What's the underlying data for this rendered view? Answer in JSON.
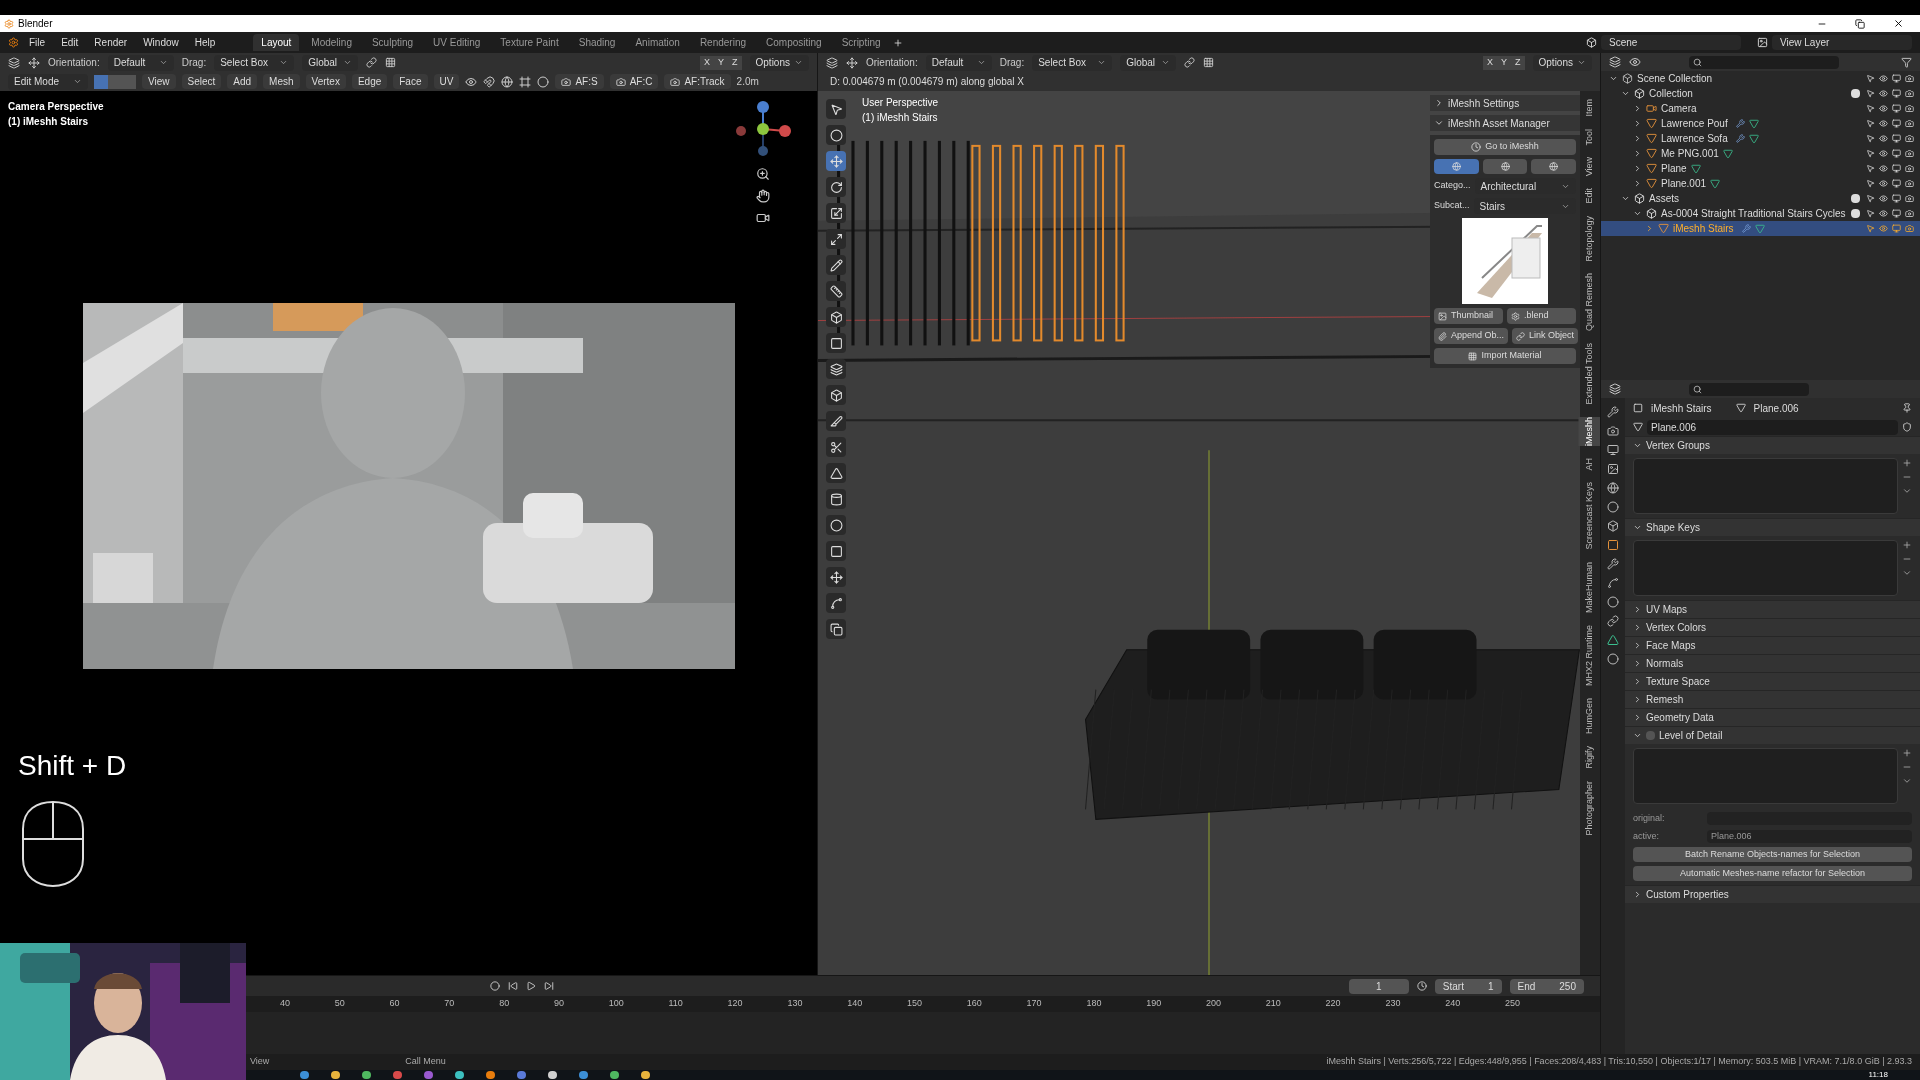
{
  "window": {
    "title": "Blender"
  },
  "menu": [
    "File",
    "Edit",
    "Render",
    "Window",
    "Help"
  ],
  "workspaces": [
    {
      "label": "Layout",
      "selected": true
    },
    {
      "label": "Modeling",
      "selected": false
    },
    {
      "label": "Sculpting",
      "selected": false
    },
    {
      "label": "UV Editing",
      "selected": false
    },
    {
      "label": "Texture Paint",
      "selected": false
    },
    {
      "label": "Shading",
      "selected": false
    },
    {
      "label": "Animation",
      "selected": false
    },
    {
      "label": "Rendering",
      "selected": false
    },
    {
      "label": "Compositing",
      "selected": false
    },
    {
      "label": "Scripting",
      "selected": false
    }
  ],
  "scene": "Scene",
  "view_layer": "View Layer",
  "left_view": {
    "header": {
      "orientation_label": "Orientation:",
      "orientation": "Default",
      "drag_label": "Drag:",
      "drag": "Select Box",
      "transform": "Global",
      "axes": [
        "X",
        "Y",
        "Z"
      ],
      "options": "Options"
    },
    "mode": "Edit Mode",
    "select_modes": [
      {
        "selected": true
      },
      {
        "selected": false
      },
      {
        "selected": false
      }
    ],
    "menus": [
      "View",
      "Select",
      "Add",
      "Mesh",
      "Vertex",
      "Edge",
      "Face",
      "UV"
    ],
    "addon_buttons": [
      "AF:S",
      "AF:C",
      "AF:Track"
    ],
    "distance": "2.0m",
    "overlay": [
      "Camera Perspective",
      "(1) iMeshh Stairs"
    ],
    "shortcut": "Shift + D"
  },
  "right_view": {
    "header": {
      "orientation_label": "Orientation:",
      "orientation": "Default",
      "drag_label": "Drag:",
      "drag": "Select Box",
      "transform": "Global",
      "axes": [
        "X",
        "Y",
        "Z"
      ],
      "options": "Options"
    },
    "status": "D: 0.004679 m (0.004679 m) along global X",
    "overlay": [
      "User Perspective",
      "(1) iMeshh Stairs"
    ]
  },
  "n_panel": {
    "panels": [
      {
        "title": "iMeshh Settings",
        "expanded": false
      },
      {
        "title": "iMeshh Asset Manager",
        "expanded": true
      }
    ],
    "go_button": "Go to iMeshh",
    "asset_types": [
      {
        "selected": true
      },
      {
        "selected": false
      },
      {
        "selected": false
      }
    ],
    "category_label": "Catego...",
    "category": "Architectural",
    "subcategory_label": "Subcat...",
    "subcategory": "Stairs",
    "thumbnail_button": "Thumbnail",
    "blend_button": ".blend",
    "append_button": "Append Ob...",
    "link_button": "Link Object",
    "import_button": "Import Material",
    "tabs": [
      {
        "label": "Item",
        "selected": false
      },
      {
        "label": "Tool",
        "selected": false
      },
      {
        "label": "View",
        "selected": false
      },
      {
        "label": "Edit",
        "selected": false
      },
      {
        "label": "Retopology",
        "selected": false
      },
      {
        "label": "Quad Remesh",
        "selected": false
      },
      {
        "label": "Extended Tools",
        "selected": false
      },
      {
        "label": "iMeshh",
        "selected": true
      },
      {
        "label": "AH",
        "selected": false
      },
      {
        "label": "Screencast Keys",
        "selected": false
      },
      {
        "label": "MakeHuman",
        "selected": false
      },
      {
        "label": "MHX2 Runtime",
        "selected": false
      },
      {
        "label": "HumGen",
        "selected": false
      },
      {
        "label": "Rigify",
        "selected": false
      },
      {
        "label": "Photographer",
        "selected": false
      }
    ]
  },
  "outliner": {
    "tree": [
      {
        "name": "Scene Collection",
        "kind": "scene",
        "selected": false,
        "children": [
          {
            "name": "Collection",
            "kind": "collection",
            "selected": false,
            "checked": true,
            "children": [
              {
                "name": "Camera",
                "kind": "camera",
                "selected": false
              },
              {
                "name": "Lawrence Pouf",
                "kind": "mesh",
                "selected": false,
                "modifiers": true
              },
              {
                "name": "Lawrence Sofa",
                "kind": "mesh",
                "selected": false,
                "modifiers": true
              },
              {
                "name": "Me PNG.001",
                "kind": "mesh",
                "selected": false,
                "modifiers": false
              },
              {
                "name": "Plane",
                "kind": "mesh",
                "selected": false,
                "modifiers": false
              },
              {
                "name": "Plane.001",
                "kind": "mesh",
                "selected": false,
                "modifiers": false
              }
            ]
          },
          {
            "name": "Assets",
            "kind": "collection",
            "selected": false,
            "checked": true,
            "children": [
              {
                "name": "As-0004 Straight Traditional Stairs Cycles",
                "kind": "collection",
                "selected": false,
                "checked": true,
                "children": [
                  {
                    "name": "iMeshh Stairs",
                    "kind": "mesh",
                    "selected": true,
                    "modifiers": true
                  }
                ]
              }
            ]
          }
        ]
      }
    ]
  },
  "properties": {
    "object": "iMeshh Stairs",
    "mesh": "Plane.006",
    "data_name": "Plane.006",
    "panels": [
      {
        "title": "Vertex Groups",
        "kind": "list",
        "expanded": true
      },
      {
        "title": "Shape Keys",
        "kind": "list",
        "expanded": true
      },
      {
        "title": "UV Maps",
        "kind": "closed",
        "expanded": false
      },
      {
        "title": "Vertex Colors",
        "kind": "closed",
        "expanded": false
      },
      {
        "title": "Face Maps",
        "kind": "closed",
        "expanded": false
      },
      {
        "title": "Normals",
        "kind": "closed",
        "expanded": false
      },
      {
        "title": "Texture Space",
        "kind": "closed",
        "expanded": false
      },
      {
        "title": "Remesh",
        "kind": "closed",
        "expanded": false
      },
      {
        "title": "Geometry Data",
        "kind": "closed",
        "expanded": false
      },
      {
        "title": "Level of Detail",
        "kind": "lod",
        "expanded": true,
        "checked": false,
        "original_label": "original:",
        "active_label": "active:",
        "active": "Plane.006",
        "buttons": [
          "Batch Rename Objects-names for Selection",
          "Automatic Meshes-name refactor for Selection"
        ]
      },
      {
        "title": "Custom Properties",
        "kind": "closed",
        "expanded": false
      }
    ]
  },
  "timeline": {
    "current": "1",
    "start_label": "Start",
    "start": "1",
    "end_label": "End",
    "end": "250",
    "ticks": [
      "40",
      "50",
      "60",
      "70",
      "80",
      "90",
      "100",
      "110",
      "120",
      "130",
      "140",
      "150",
      "160",
      "170",
      "180",
      "190",
      "200",
      "210",
      "220",
      "230",
      "240",
      "250"
    ]
  },
  "footer": {
    "view": "View",
    "call_menu": "Call Menu",
    "stats": "iMeshh Stairs | Verts:256/5,722 | Edges:448/9,955 | Faces:208/4,483 | Tris:10,550 | Objects:1/17 | Memory: 503.5 MiB | VRAM: 7.1/8.0 GiB | 2.93.3"
  },
  "taskbar": {
    "time": "11:18"
  }
}
